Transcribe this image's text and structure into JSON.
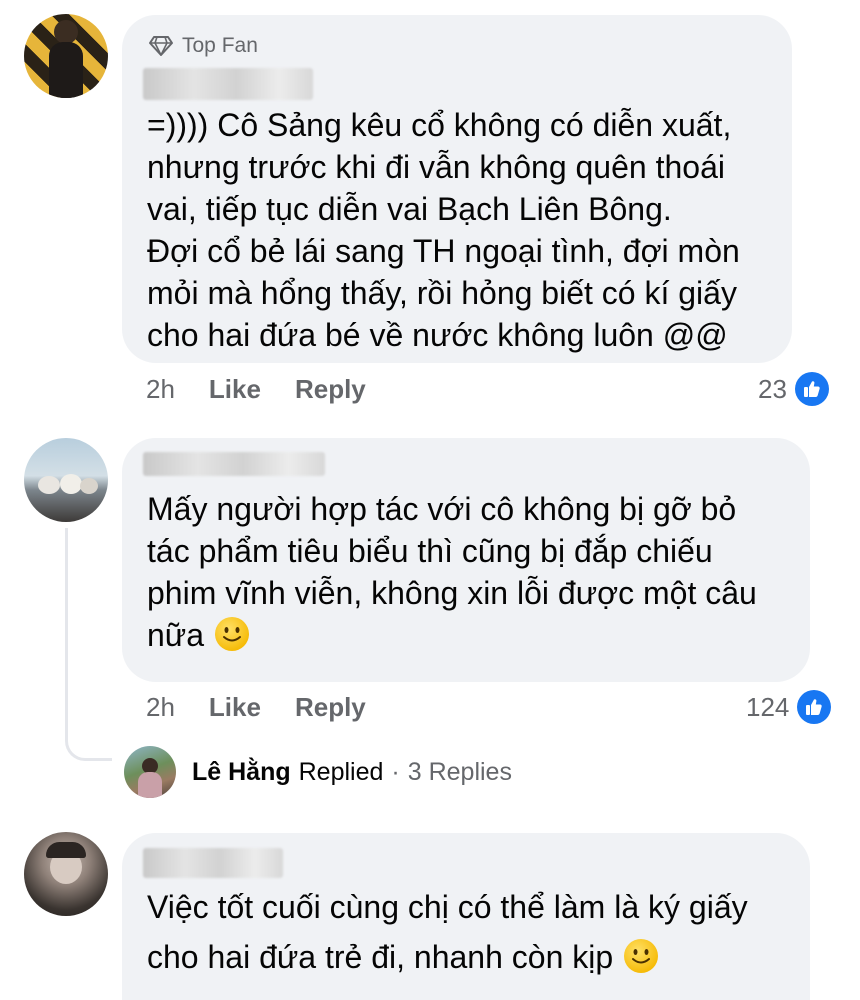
{
  "comments": [
    {
      "badge": "Top Fan",
      "lines": [
        "=)))) Cô Sảng kêu cổ không có diễn xuất,",
        "nhưng trước khi đi vẫn không quên thoái",
        "vai, tiếp tục diễn vai Bạch Liên Bông.",
        "Đợi cổ bẻ lái sang TH ngoại tình, đợi mòn",
        "mỏi mà hổng thấy, rồi hỏng biết có kí giấy",
        "cho hai đứa bé về nước không luôn @@"
      ],
      "time": "2h",
      "like_label": "Like",
      "reply_label": "Reply",
      "reactions": "23"
    },
    {
      "lines": [
        "Mấy người hợp tác với cô không bị gỡ bỏ",
        "tác phẩm tiêu biểu thì cũng bị đắp chiếu",
        "phim vĩnh viễn, không xin lỗi được một câu",
        "nữa"
      ],
      "time": "2h",
      "like_label": "Like",
      "reply_label": "Reply",
      "reactions": "124",
      "replies": {
        "name": "Lê Hằng",
        "action": "Replied",
        "separator": "·",
        "count": "3 Replies"
      }
    },
    {
      "lines": [
        "Việc tốt cuối cùng chị có thể làm là ký giấy",
        "cho hai đứa trẻ đi, nhanh còn kịp"
      ]
    }
  ],
  "colors": {
    "bubble": "#f0f2f5",
    "meta_text": "#65676b",
    "like_blue": "#1877f2",
    "thread_line": "#e4e6eb"
  },
  "icons": [
    "diamond-icon",
    "like-reaction-icon",
    "smile-emoji-icon"
  ]
}
